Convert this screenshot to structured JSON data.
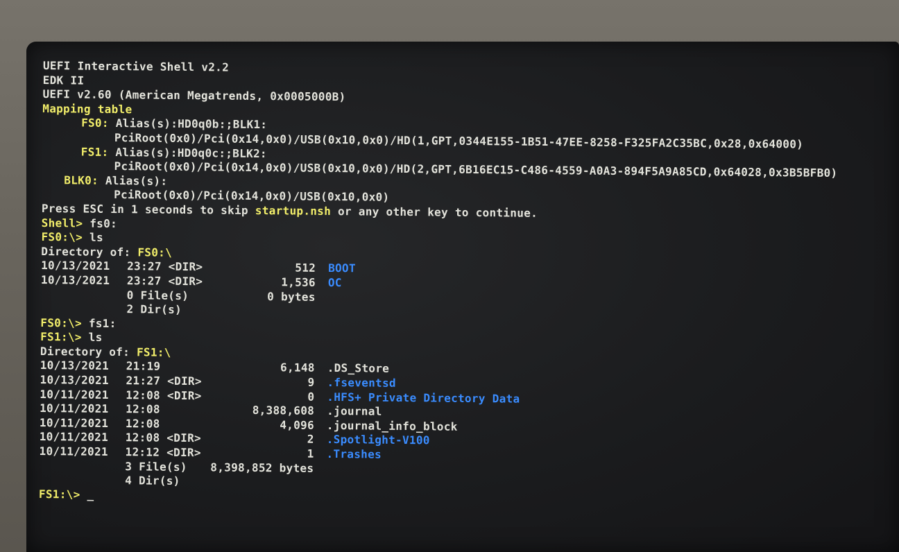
{
  "colors": {
    "text": "#e4e4dc",
    "highlight": "#f2ee6a",
    "dir_name": "#3a8cff",
    "background": "#1b1c1e"
  },
  "banner": {
    "line1": "UEFI Interactive Shell v2.2",
    "line2": "EDK II",
    "line3": "UEFI v2.60 (American Megatrends, 0x0005000B)",
    "mapping": "Mapping table"
  },
  "mappings": [
    {
      "label": "FS0:",
      "alias": " Alias(s):HD0q0b:;BLK1:",
      "path": "PciRoot(0x0)/Pci(0x14,0x0)/USB(0x10,0x0)/HD(1,GPT,0344E155-1B51-47EE-8258-F325FA2C35BC,0x28,0x64000)"
    },
    {
      "label": "FS1:",
      "alias": " Alias(s):HD0q0c:;BLK2:",
      "path": "PciRoot(0x0)/Pci(0x14,0x0)/USB(0x10,0x0)/HD(2,GPT,6B16EC15-C486-4559-A0A3-894F5A9A85CD,0x64028,0x3B5BFB0)"
    },
    {
      "label": "BLK0:",
      "alias": " Alias(s):",
      "path": "PciRoot(0x0)/Pci(0x14,0x0)/USB(0x10,0x0)"
    }
  ],
  "startup": {
    "pre": "Press ESC in 1 seconds to skip ",
    "file": "startup.nsh",
    "post": " or any other key to continue."
  },
  "session1": {
    "prompt1": "Shell> ",
    "cmd1": "fs0:",
    "prompt2": "FS0:\\> ",
    "cmd2": "ls",
    "dir_label": "Directory of: ",
    "dir_path": "FS0:\\",
    "entries": [
      {
        "date": "10/13/2021",
        "time": "23:27 <DIR>",
        "size": "512",
        "name": "BOOT",
        "is_dir": true
      },
      {
        "date": "10/13/2021",
        "time": "23:27 <DIR>",
        "size": "1,536",
        "name": "OC",
        "is_dir": true
      }
    ],
    "files_label": "0 File(s)",
    "files_bytes": "0 bytes",
    "dirs_label": "2 Dir(s)"
  },
  "session2": {
    "prompt1": "FS0:\\> ",
    "cmd1": "fs1:",
    "prompt2": "FS1:\\> ",
    "cmd2": "ls",
    "dir_label": "Directory of: ",
    "dir_path": "FS1:\\",
    "entries": [
      {
        "date": "10/13/2021",
        "time": "21:19",
        "size": "6,148",
        "name": ".DS_Store",
        "is_dir": false
      },
      {
        "date": "10/13/2021",
        "time": "21:27 <DIR>",
        "size": "9",
        "name": ".fseventsd",
        "is_dir": true
      },
      {
        "date": "10/11/2021",
        "time": "12:08 <DIR>",
        "size": "0",
        "name": ".HFS+ Private Directory Data",
        "is_dir": true
      },
      {
        "date": "10/11/2021",
        "time": "12:08",
        "size": "8,388,608",
        "name": ".journal",
        "is_dir": false
      },
      {
        "date": "10/11/2021",
        "time": "12:08",
        "size": "4,096",
        "name": ".journal_info_block",
        "is_dir": false
      },
      {
        "date": "10/11/2021",
        "time": "12:08 <DIR>",
        "size": "2",
        "name": ".Spotlight-V100",
        "is_dir": true
      },
      {
        "date": "10/11/2021",
        "time": "12:12 <DIR>",
        "size": "1",
        "name": ".Trashes",
        "is_dir": true
      }
    ],
    "files_label": "3 File(s)",
    "files_bytes": "8,398,852 bytes",
    "dirs_label": "4 Dir(s)"
  },
  "final_prompt": "FS1:\\> ",
  "cursor": "_"
}
